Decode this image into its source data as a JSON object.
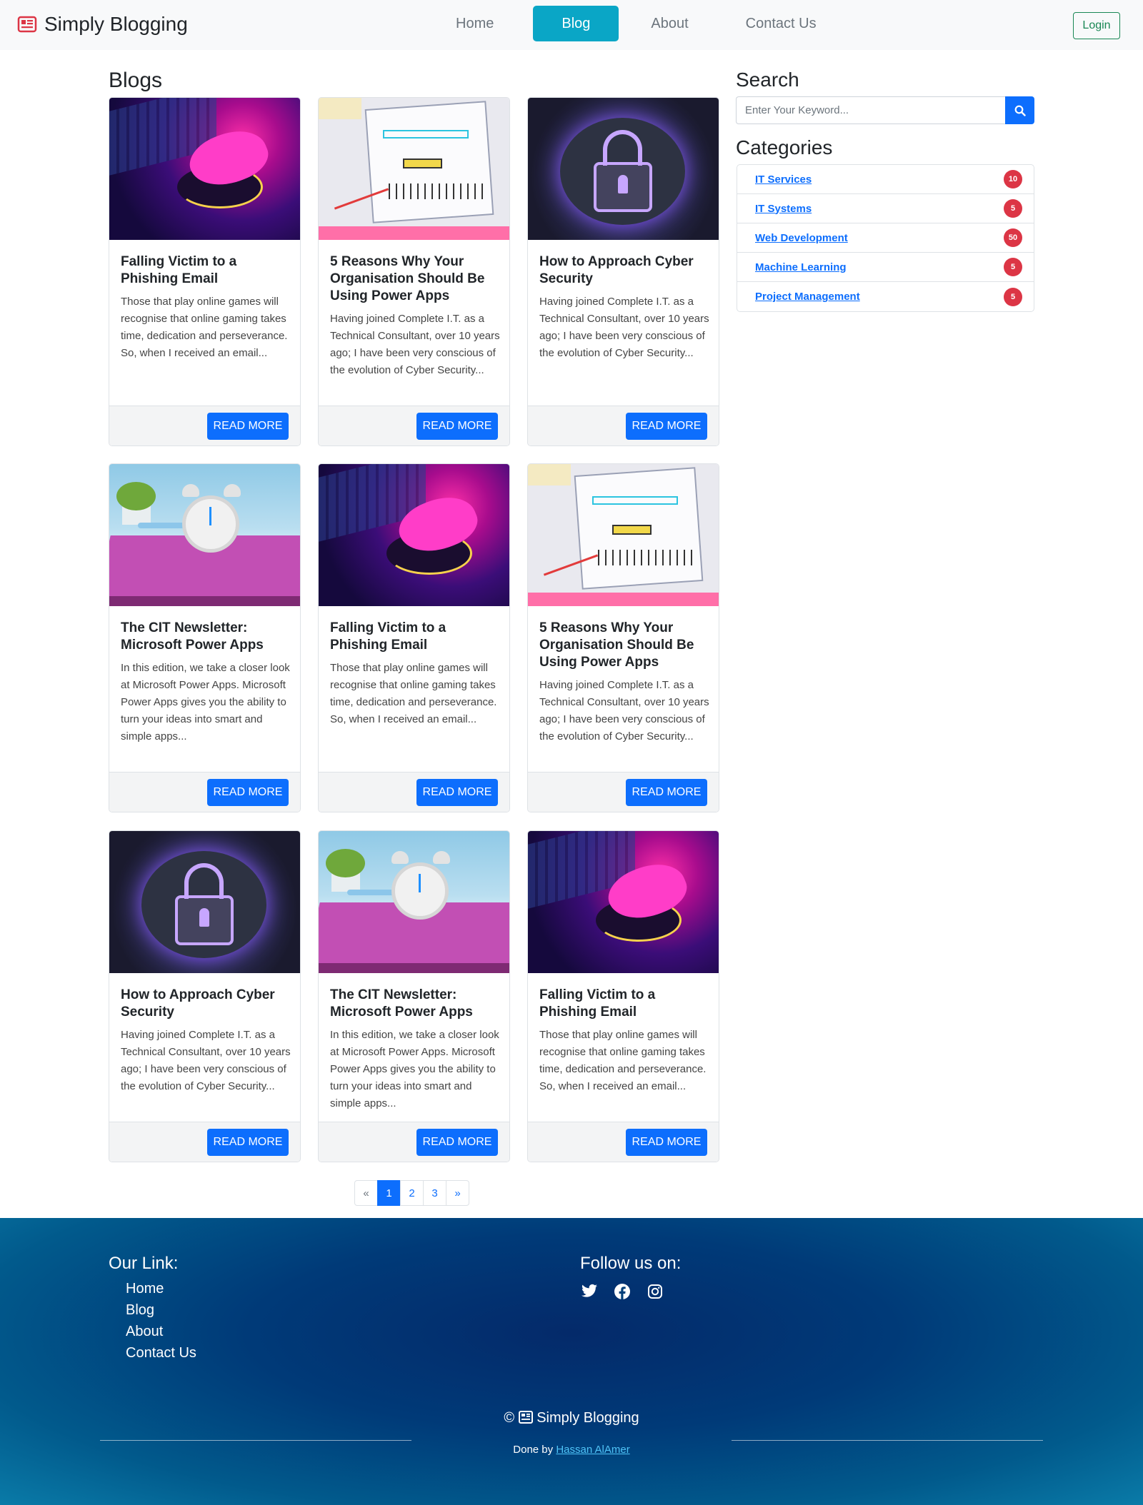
{
  "brand": {
    "name": "Simply Blogging"
  },
  "nav": {
    "items": [
      {
        "label": "Home"
      },
      {
        "label": "Blog"
      },
      {
        "label": "About"
      },
      {
        "label": "Contact Us"
      }
    ],
    "login_label": "Login"
  },
  "blogs": {
    "heading": "Blogs",
    "read_more_label": "READ MORE",
    "posts": [
      {
        "title": "Falling Victim to a Phishing Email",
        "excerpt": "Those that play online games will recognise that online gaming takes time, dedication and perseverance. So, when I received an email...",
        "image": "mouse-photo"
      },
      {
        "title": "5 Reasons Why Your Organisation Should Be Using Power Apps",
        "excerpt": "Having joined Complete I.T. as a Technical Consultant, over 10 years ago; I have been very conscious of the evolution of Cyber Security...",
        "image": "wireframe-sketch-photo"
      },
      {
        "title": "How to Approach Cyber Security",
        "excerpt": "Having joined Complete I.T. as a Technical Consultant, over 10 years ago; I have been very conscious of the evolution of Cyber Security...",
        "image": "digital-lock-photo"
      },
      {
        "title": "The CIT Newsletter: Microsoft Power Apps",
        "excerpt": "In this edition, we take a closer look at Microsoft Power Apps. Microsoft Power Apps gives you the ability to turn your ideas into smart and simple apps...",
        "image": "alarm-clock-photo"
      },
      {
        "title": "Falling Victim to a Phishing Email",
        "excerpt": "Those that play online games will recognise that online gaming takes time, dedication and perseverance. So, when I received an email...",
        "image": "mouse-photo"
      },
      {
        "title": "5 Reasons Why Your Organisation Should Be Using Power Apps",
        "excerpt": "Having joined Complete I.T. as a Technical Consultant, over 10 years ago; I have been very conscious of the evolution of Cyber Security...",
        "image": "wireframe-sketch-photo"
      },
      {
        "title": "How to Approach Cyber Security",
        "excerpt": "Having joined Complete I.T. as a Technical Consultant, over 10 years ago; I have been very conscious of the evolution of Cyber Security...",
        "image": "digital-lock-photo"
      },
      {
        "title": "The CIT Newsletter: Microsoft Power Apps",
        "excerpt": "In this edition, we take a closer look at Microsoft Power Apps. Microsoft Power Apps gives you the ability to turn your ideas into smart and simple apps...",
        "image": "alarm-clock-photo"
      },
      {
        "title": "Falling Victim to a Phishing Email",
        "excerpt": "Those that play online games will recognise that online gaming takes time, dedication and perseverance. So, when I received an email...",
        "image": "mouse-photo"
      }
    ]
  },
  "sidebar": {
    "search_heading": "Search",
    "search_placeholder": "Enter Your Keyword...",
    "categories_heading": "Categories",
    "categories": [
      {
        "label": "IT Services",
        "count": "10"
      },
      {
        "label": "IT Systems",
        "count": "5"
      },
      {
        "label": "Web Development",
        "count": "50"
      },
      {
        "label": "Machine Learning",
        "count": "5"
      },
      {
        "label": "Project Management",
        "count": "5"
      }
    ]
  },
  "pagination": {
    "prev": "«",
    "pages": [
      "1",
      "2",
      "3"
    ],
    "next": "»",
    "current": "1"
  },
  "footer": {
    "links_heading": "Our Link:",
    "links": [
      "Home",
      "Blog",
      "About",
      "Contact Us"
    ],
    "follow_heading": "Follow us on:",
    "social": [
      "twitter-icon",
      "facebook-icon",
      "instagram-icon"
    ],
    "copyright_symbol": "©",
    "brand": "Simply Blogging",
    "credit_prefix": "Done by",
    "credit_name": "Hassan AlAmer"
  },
  "colors": {
    "accent": "#0aa6c6",
    "primary": "#0d6efd",
    "badge": "#dc3545",
    "login": "#198754"
  }
}
